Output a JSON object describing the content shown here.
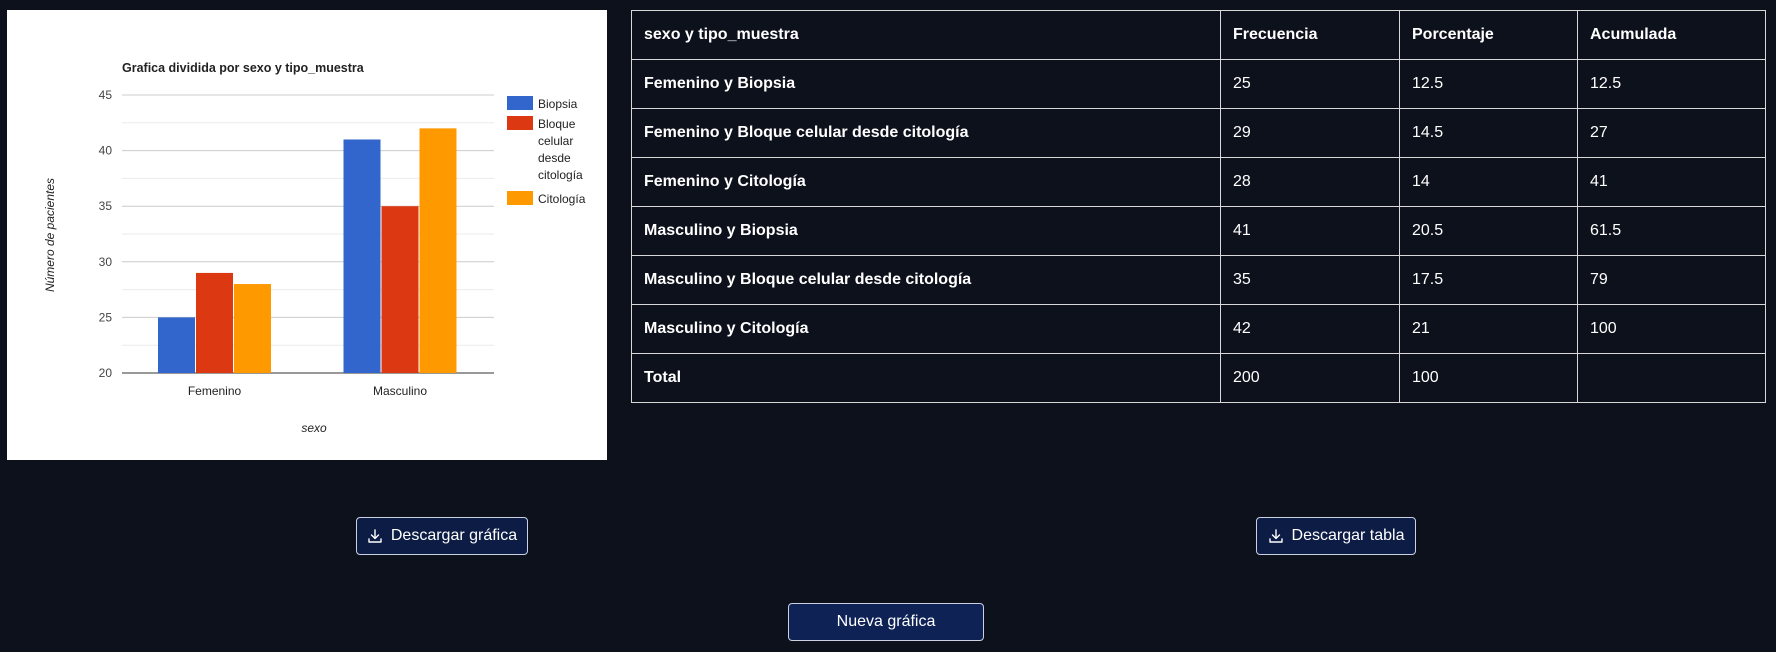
{
  "chart_data": {
    "type": "bar",
    "title": "Grafica dividida por sexo y tipo_muestra",
    "xlabel": "sexo",
    "ylabel": "Número de pacientes",
    "categories": [
      "Femenino",
      "Masculino"
    ],
    "series": [
      {
        "name": "Biopsia",
        "values": [
          25,
          41
        ],
        "color": "#3366cc"
      },
      {
        "name": "Bloque celular desde citología",
        "values": [
          29,
          35
        ],
        "color": "#dc3912"
      },
      {
        "name": "Citología",
        "values": [
          28,
          42
        ],
        "color": "#ff9900"
      }
    ],
    "legend_lines": [
      [
        "Biopsia"
      ],
      [
        "Bloque",
        "celular",
        "desde",
        "citología"
      ],
      [
        "Citología"
      ]
    ],
    "ylim": [
      20,
      45
    ],
    "yticks": [
      20,
      25,
      30,
      35,
      40,
      45
    ],
    "grid": true,
    "legend_position": "right"
  },
  "table": {
    "headers": [
      "sexo y tipo_muestra",
      "Frecuencia",
      "Porcentaje",
      "Acumulada"
    ],
    "rows": [
      [
        "Femenino y Biopsia",
        "25",
        "12.5",
        "12.5"
      ],
      [
        "Femenino y Bloque celular desde citología",
        "29",
        "14.5",
        "27"
      ],
      [
        "Femenino y Citología",
        "28",
        "14",
        "41"
      ],
      [
        "Masculino y Biopsia",
        "41",
        "20.5",
        "61.5"
      ],
      [
        "Masculino y Bloque celular desde citología",
        "35",
        "17.5",
        "79"
      ],
      [
        "Masculino y Citología",
        "42",
        "21",
        "100"
      ],
      [
        "Total",
        "200",
        "100",
        ""
      ]
    ]
  },
  "buttons": {
    "download_chart": "Descargar gráfica",
    "download_table": "Descargar tabla",
    "new_chart": "Nueva gráfica"
  },
  "icons": {
    "download": "download-icon"
  }
}
